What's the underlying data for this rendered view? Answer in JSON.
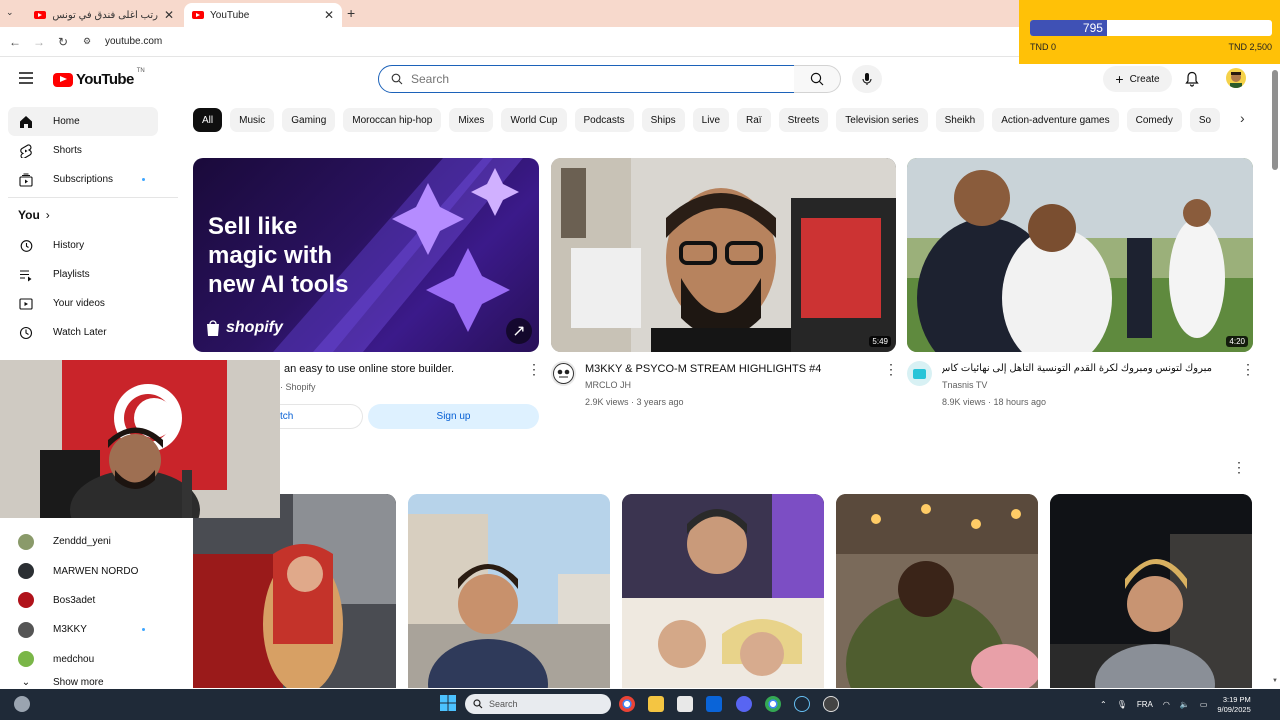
{
  "browser": {
    "tabs": [
      {
        "title": "رتب أغلى فندق في تونس ل",
        "active": false
      },
      {
        "title": "YouTube",
        "active": true
      }
    ],
    "url": "youtube.com"
  },
  "donation_goal": {
    "current": "795",
    "min_label": "TND 0",
    "max_label": "TND 2,500",
    "progress_fraction": 0.318
  },
  "header": {
    "logo_text": "YouTube",
    "logo_country": "TN",
    "search_placeholder": "Search",
    "create_label": "Create"
  },
  "sidebar": {
    "items": [
      {
        "label": "Home",
        "icon": "home-icon",
        "active": true
      },
      {
        "label": "Shorts",
        "icon": "shorts-icon"
      },
      {
        "label": "Subscriptions",
        "icon": "subscriptions-icon",
        "dot": true
      }
    ],
    "you_heading": "You",
    "you_items": [
      {
        "label": "History",
        "icon": "history-icon"
      },
      {
        "label": "Playlists",
        "icon": "playlists-icon"
      },
      {
        "label": "Your videos",
        "icon": "your-videos-icon"
      },
      {
        "label": "Watch Later",
        "icon": "watch-later-icon"
      }
    ],
    "subscriptions": [
      {
        "name": "Zenddd_yeni",
        "color": "#8a9a6a"
      },
      {
        "name": "MARWEN NORDO",
        "color": "#2b2f33"
      },
      {
        "name": "Bos3adet",
        "color": "#b0121a"
      },
      {
        "name": "M3KKY",
        "color": "#555555",
        "dot": true
      },
      {
        "name": "medchou",
        "color": "#7ab648"
      }
    ],
    "show_more": "Show more"
  },
  "chips": [
    "All",
    "Music",
    "Gaming",
    "Moroccan hip-hop",
    "Mixes",
    "World Cup",
    "Podcasts",
    "Ships",
    "Live",
    "Raï",
    "Streets",
    "Television series",
    "Sheikh",
    "Action-adventure games",
    "Comedy",
    "So"
  ],
  "ad": {
    "headline_lines": [
      "Sell like",
      "magic with",
      "new AI tools"
    ],
    "brand": "shopify",
    "title": "an easy to use online store builder.",
    "sponsor": "· Shopify",
    "watch_label": "tch",
    "signup_label": "Sign up"
  },
  "videos": [
    {
      "title": "M3KKY & PSYCO-M STREAM HIGHLIGHTS #4",
      "channel": "MRCLO JH",
      "stats": "2.9K views · 3 years ago",
      "duration": "5:49"
    },
    {
      "title": "مبروك لتونس ومبروك لكرة القدم التونسية التأهل إلى نهائيات كأس العالم",
      "channel": "Tnasnis TV",
      "stats": "8.9K views · 18 hours ago",
      "duration": "4:20"
    }
  ],
  "taskbar": {
    "search_label": "Search",
    "language": "FRA",
    "time": "3:19 PM",
    "date": "9/09/2025"
  },
  "colors": {
    "accent_red": "#ff0000",
    "chip_active": "#0f0f0f",
    "donation_bg": "#ffc107",
    "donation_fill": "#3f51b5",
    "signup_blue": "#def1ff"
  }
}
